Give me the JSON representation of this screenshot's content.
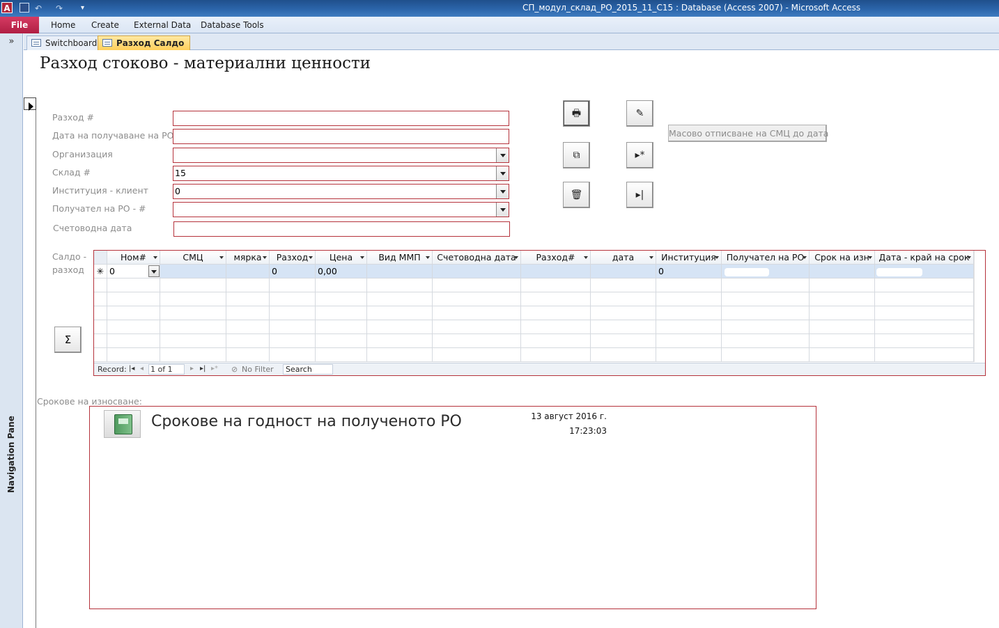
{
  "window": {
    "title": "СП_модул_склад_РО_2015_11_С15 : Database (Access 2007)  -  Microsoft Access",
    "app_icon": "A"
  },
  "quick_access": {
    "undo_glyph": "↶",
    "redo_glyph": "↷",
    "customize_glyph": "▾"
  },
  "ribbon": {
    "file": "File",
    "tabs": [
      "Home",
      "Create",
      "External Data",
      "Database Tools"
    ]
  },
  "nav_pane": {
    "label": "Navigation Pane",
    "toggle": "»"
  },
  "doc_tabs": [
    {
      "label": "Switchboard",
      "active": false
    },
    {
      "label": "Разход Салдо",
      "active": true
    }
  ],
  "form": {
    "title": "Разход  стоково - материални ценности",
    "fields": [
      {
        "label": "Разход #",
        "value": "",
        "type": "text"
      },
      {
        "label": "Дата на получаване на РО",
        "value": "",
        "type": "text"
      },
      {
        "label": "Организация",
        "value": "",
        "type": "combo"
      },
      {
        "label": "Склад #",
        "value": "15",
        "type": "combo"
      },
      {
        "label": "Институция - клиент",
        "value": "0",
        "type": "combo"
      },
      {
        "label": "Получател на РО - #",
        "value": "",
        "type": "combo"
      },
      {
        "label": "Счетоводна дата",
        "value": "",
        "type": "text"
      }
    ],
    "buttons": {
      "print_icon": "🖶",
      "edit_icon": "✎",
      "copy_icon": "⧉",
      "new_record_icon": "▸*",
      "delete_icon": "🗑",
      "last_record_icon": "▸|",
      "mass_writeoff": "Масово отписване на СМЦ до дата",
      "sum_icon": "Σ"
    }
  },
  "subform": {
    "label_line1": "Салдо -",
    "label_line2": "разход",
    "columns": [
      "Ном#",
      "СМЦ",
      "мярка",
      "Разход",
      "Цена",
      "Вид ММП",
      "Счетоводна дата",
      "Разход#",
      "дата",
      "Институция",
      "Получател на РО",
      "Срок на изн",
      "Дата - край на срок"
    ],
    "new_row": {
      "marker": "✳",
      "cells": [
        "0",
        "",
        "",
        "0",
        "0,00",
        "",
        "",
        "",
        "",
        "0",
        "",
        "",
        ""
      ]
    },
    "navigation": {
      "record_label": "Record:",
      "position": "1 of 1",
      "filter": "No Filter",
      "search": "Search"
    }
  },
  "report": {
    "label": "Срокове на износване:",
    "title": "Срокове на годност на полученото РО",
    "date": "13 август 2016 г.",
    "time": "17:23:03"
  }
}
